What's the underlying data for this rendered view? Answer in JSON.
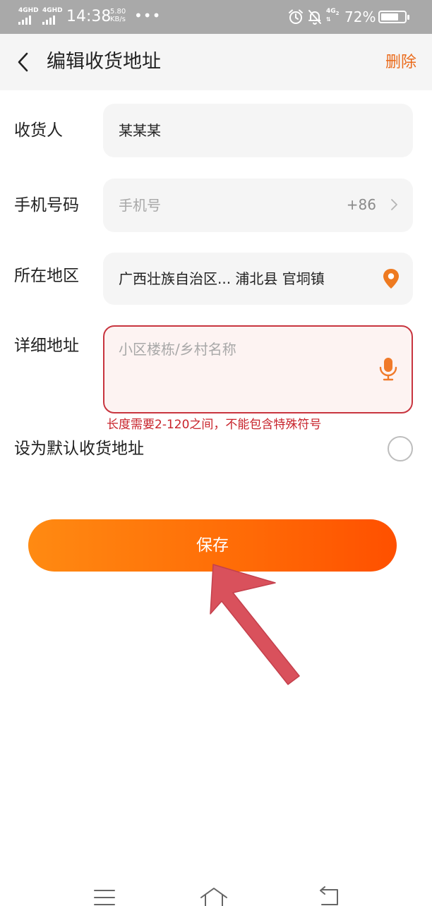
{
  "status_bar": {
    "signal_1": "4GHD",
    "signal_2": "4GHD",
    "time": "14:38",
    "speed_value": "5.80",
    "speed_unit": "KB/s",
    "dots": "•••",
    "network_sim2": "4G",
    "battery_pct": "72%"
  },
  "header": {
    "title": "编辑收货地址",
    "delete_label": "删除"
  },
  "form": {
    "recipient": {
      "label": "收货人",
      "value": "某某某"
    },
    "phone": {
      "label": "手机号码",
      "placeholder": "手机号",
      "country_code": "+86"
    },
    "region": {
      "label": "所在地区",
      "value": "广西壮族自治区... 浦北县 官垌镇"
    },
    "detail": {
      "label": "详细地址",
      "placeholder": "小区楼栋/乡村名称",
      "error": "长度需要2-120之间，不能包含特殊符号"
    },
    "default_toggle": {
      "label": "设为默认收货地址",
      "checked": false
    }
  },
  "save_label": "保存",
  "colors": {
    "accent": "#ea6a1a",
    "button_gradient_start": "#ff8a12",
    "button_gradient_end": "#ff5000",
    "error": "#c8232b",
    "annotation_arrow": "#d9515c"
  }
}
